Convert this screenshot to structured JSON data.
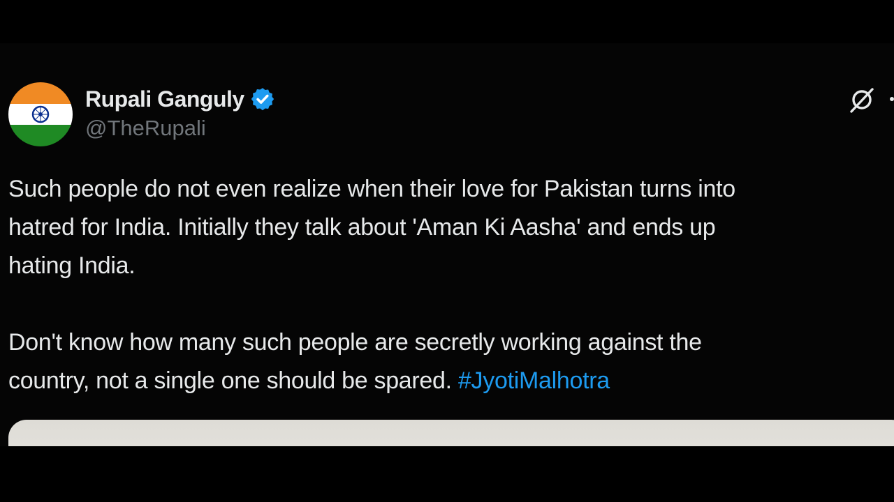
{
  "author": {
    "display_name": "Rupali Ganguly",
    "handle": "@TheRupali",
    "verified": true,
    "avatar_icon": "india-flag-icon"
  },
  "tweet": {
    "paragraph1_lines": [
      "Such people do not even realize when their love for Pakistan turns into",
      "hatred for India. Initially they talk about 'Aman Ki Aasha' and ends up",
      "hating India."
    ],
    "paragraph2_lines": [
      "Don't know how many such people are secretly working against the",
      "country, not a single one should be spared."
    ],
    "hashtag": "#JyotiMalhotra"
  },
  "icons": {
    "verified": "verified-badge-icon",
    "grok": "grok-icon",
    "more": "more-icon"
  },
  "colors": {
    "background": "#000000",
    "text": "#e7e9ea",
    "secondary": "#71767b",
    "link": "#1d9bf0",
    "verified": "#1d9bf0"
  }
}
